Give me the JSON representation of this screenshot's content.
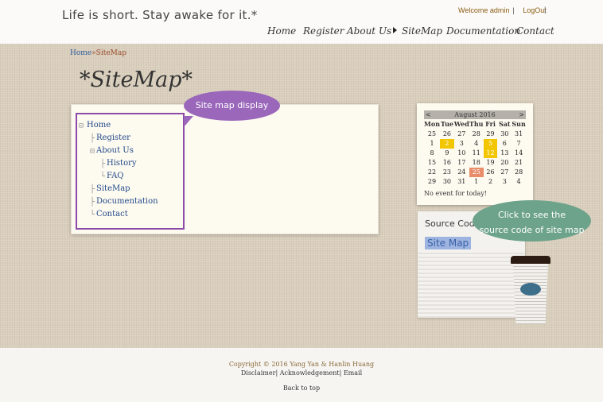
{
  "header": {
    "tagline": "Life is short. Stay awake for it.*",
    "welcome": "Welcome admin",
    "logout": "LogOut",
    "nav": [
      "Home",
      "Register",
      "About Us",
      "SiteMap",
      "Documentation",
      "Contact"
    ]
  },
  "breadcrumb": {
    "home": "Home",
    "separator": "»",
    "current": "SiteMap"
  },
  "page_title": "*SiteMap*",
  "sitemap": {
    "callout": "Site map display",
    "items": [
      {
        "label": "Home",
        "prefix": "⊟"
      },
      {
        "label": "Register",
        "prefix": "├"
      },
      {
        "label": "About Us",
        "prefix": "⊟"
      },
      {
        "label": "History",
        "prefix": "├"
      },
      {
        "label": "FAQ",
        "prefix": "└"
      },
      {
        "label": "SiteMap",
        "prefix": "├"
      },
      {
        "label": "Documentation",
        "prefix": "├"
      },
      {
        "label": "Contact",
        "prefix": "└"
      }
    ]
  },
  "calendar": {
    "prev": "<",
    "next": ">",
    "month": "August 2016",
    "dow": [
      "Mon",
      "Tue",
      "Wed",
      "Thu",
      "Fri",
      "Sat",
      "Sun"
    ],
    "days": [
      "25",
      "26",
      "27",
      "28",
      "29",
      "30",
      "31",
      "1",
      "2",
      "3",
      "4",
      "5",
      "6",
      "7",
      "8",
      "9",
      "10",
      "11",
      "12",
      "13",
      "14",
      "15",
      "16",
      "17",
      "18",
      "19",
      "20",
      "21",
      "22",
      "23",
      "24",
      "25",
      "26",
      "27",
      "28",
      "29",
      "30",
      "31",
      "1",
      "2",
      "3",
      "4"
    ],
    "event_day_indexes": [
      8,
      11,
      18
    ],
    "today_index": 31,
    "event_color": "#f2c600",
    "today_color": "#e98c6a",
    "no_event": "No event for today!"
  },
  "source_widget": {
    "title": "Source Code",
    "link": "Site Map",
    "callout_line1": "Click to see the",
    "callout_line2": "source code of site map"
  },
  "footer": {
    "copyright": "Copyright © 2016 Yang Yan & Hanlin Huang",
    "disclaimer": "Disclaimer",
    "acknowledgement": "Acknowledgement",
    "email": "Email",
    "back_to_top": "Back to top"
  }
}
